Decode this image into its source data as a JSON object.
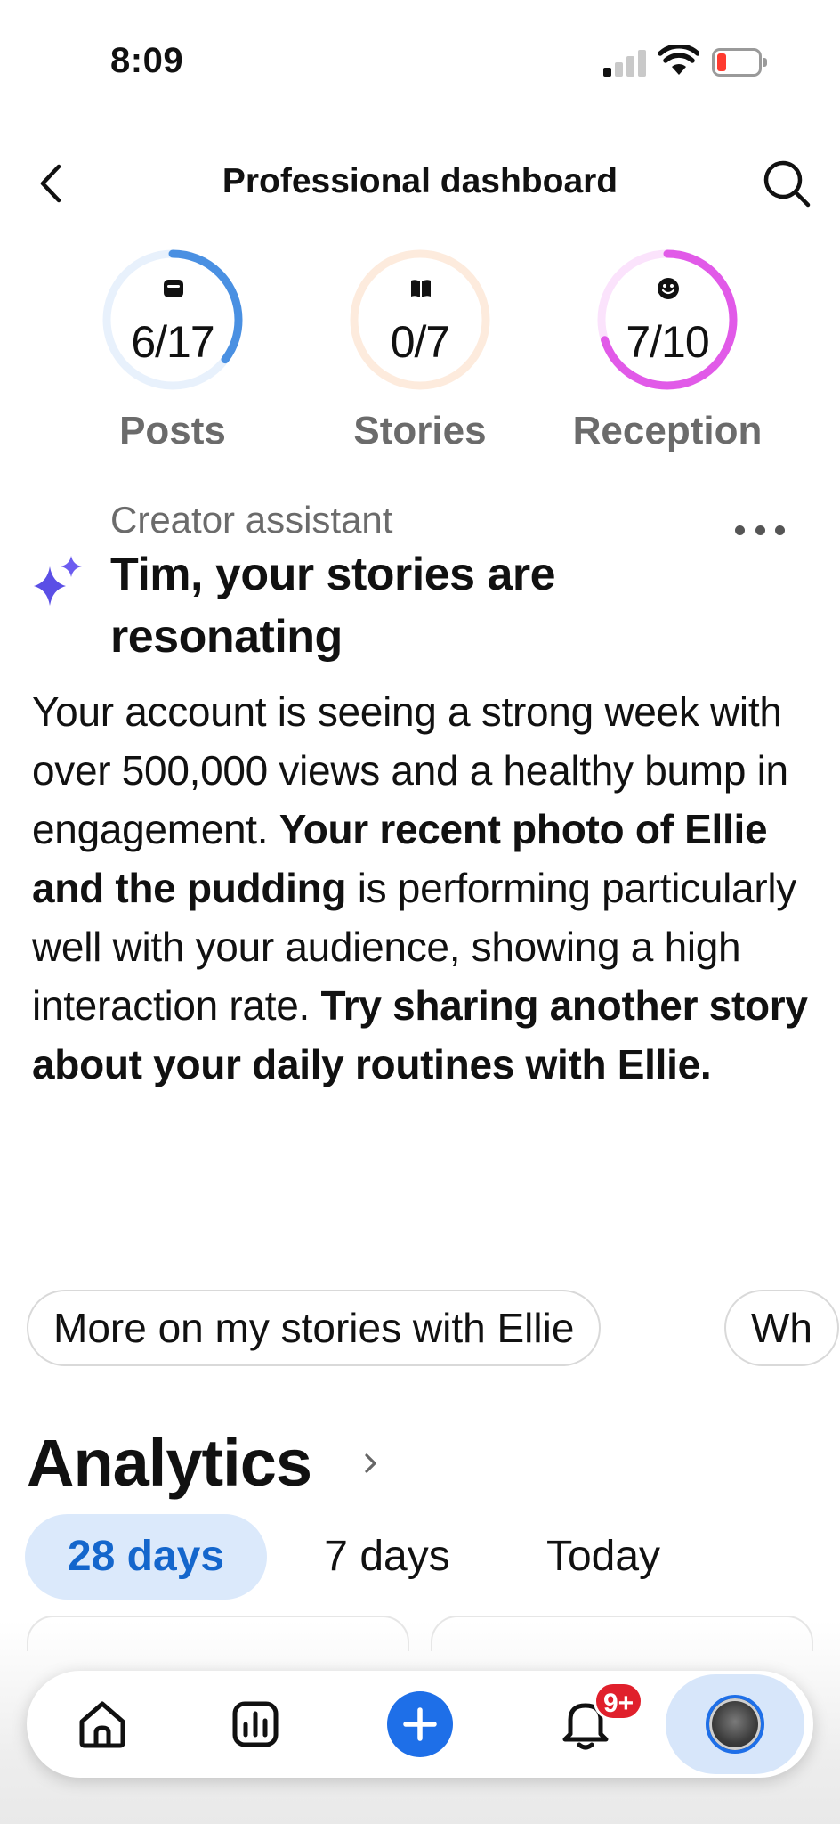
{
  "status_bar": {
    "time": "8:09",
    "battery_level": 0.15,
    "battery_color": "#ff3b30"
  },
  "header": {
    "title": "Professional dashboard",
    "back_icon": "chevron-left-icon",
    "search_icon": "search-icon"
  },
  "rings": [
    {
      "value": "6/17",
      "label": "Posts",
      "progress": 0.353,
      "color": "#4a90e2",
      "track": "#e8f1fc",
      "icon": "post-icon"
    },
    {
      "value": "0/7",
      "label": "Stories",
      "progress": 0,
      "color": "#f5a65b",
      "track": "#fdebdd",
      "icon": "book-icon"
    },
    {
      "value": "7/10",
      "label": "Reception",
      "progress": 0.7,
      "color": "#e15ae8",
      "track": "#fbe3fc",
      "icon": "smiley-icon"
    }
  ],
  "assistant": {
    "kicker": "Creator assistant",
    "heading": "Tim, your stories are resonating",
    "body_1": "Your account is seeing a strong week with over 500,000 views and a healthy bump in engagement. ",
    "body_bold_1": "Your recent photo of Ellie and the pudding",
    "body_2": " is performing particularly well with your audience, showing a high interaction rate. ",
    "body_bold_2": "Try sharing another story about your daily routines with Ellie.",
    "accent_color": "#5b4fe6"
  },
  "chips": [
    {
      "label": "More on my stories with Ellie"
    },
    {
      "label": "Wh"
    }
  ],
  "analytics": {
    "title": "Analytics",
    "tabs": [
      {
        "label": "28 days",
        "active": true
      },
      {
        "label": "7 days",
        "active": false
      },
      {
        "label": "Today",
        "active": false
      }
    ],
    "active_color": "#1466cc"
  },
  "bottom_nav": {
    "items": [
      {
        "icon": "home-icon"
      },
      {
        "icon": "analytics-icon"
      },
      {
        "icon": "plus-icon"
      },
      {
        "icon": "bell-icon",
        "badge": "9+"
      },
      {
        "icon": "profile-avatar"
      }
    ],
    "badge_color": "#e0202c"
  }
}
